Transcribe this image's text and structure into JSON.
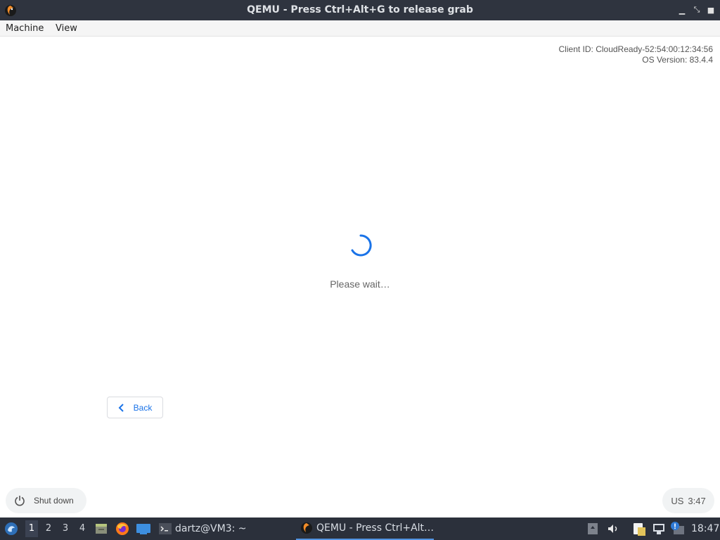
{
  "window": {
    "title": "QEMU - Press Ctrl+Alt+G to release grab"
  },
  "menu": {
    "items": [
      "Machine",
      "View"
    ]
  },
  "vm": {
    "client_id": "Client ID: CloudReady-52:54:00:12:34:56",
    "os_version": "OS Version: 83.4.4",
    "loading_text": "Please wait…",
    "back_label": "Back",
    "shutdown_label": "Shut down",
    "status": {
      "keyboard": "US",
      "time": "3:47"
    }
  },
  "taskbar": {
    "workspaces": [
      "1",
      "2",
      "3",
      "4"
    ],
    "active_workspace": "1",
    "terminal_task": "dartz@VM3: ~",
    "qemu_task": "QEMU - Press Ctrl+Alt…",
    "clock": "18:47"
  },
  "colors": {
    "titlebar_bg": "#2f343f",
    "taskbar_bg": "#2b303b",
    "accent_blue": "#1a73e8",
    "task_active_underline": "#5294e2"
  }
}
